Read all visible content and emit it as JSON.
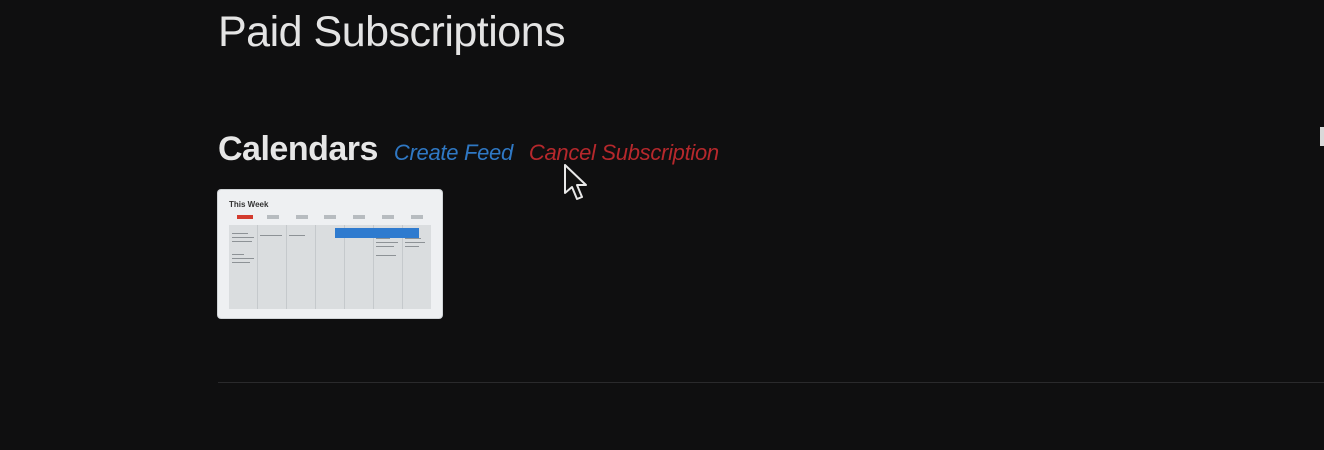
{
  "page": {
    "title": "Paid Subscriptions"
  },
  "calendars": {
    "section_title": "Calendars",
    "create_feed_label": "Create Feed",
    "cancel_subscription_label": "Cancel Subscription",
    "thumbnail": {
      "title": "This Week",
      "icon": "calendar-preview"
    }
  },
  "colors": {
    "background": "#0f0f10",
    "create_link": "#2f78c4",
    "cancel_link": "#b6282c",
    "event_block": "#2f7bcf",
    "today_marker": "#d33c2f"
  }
}
